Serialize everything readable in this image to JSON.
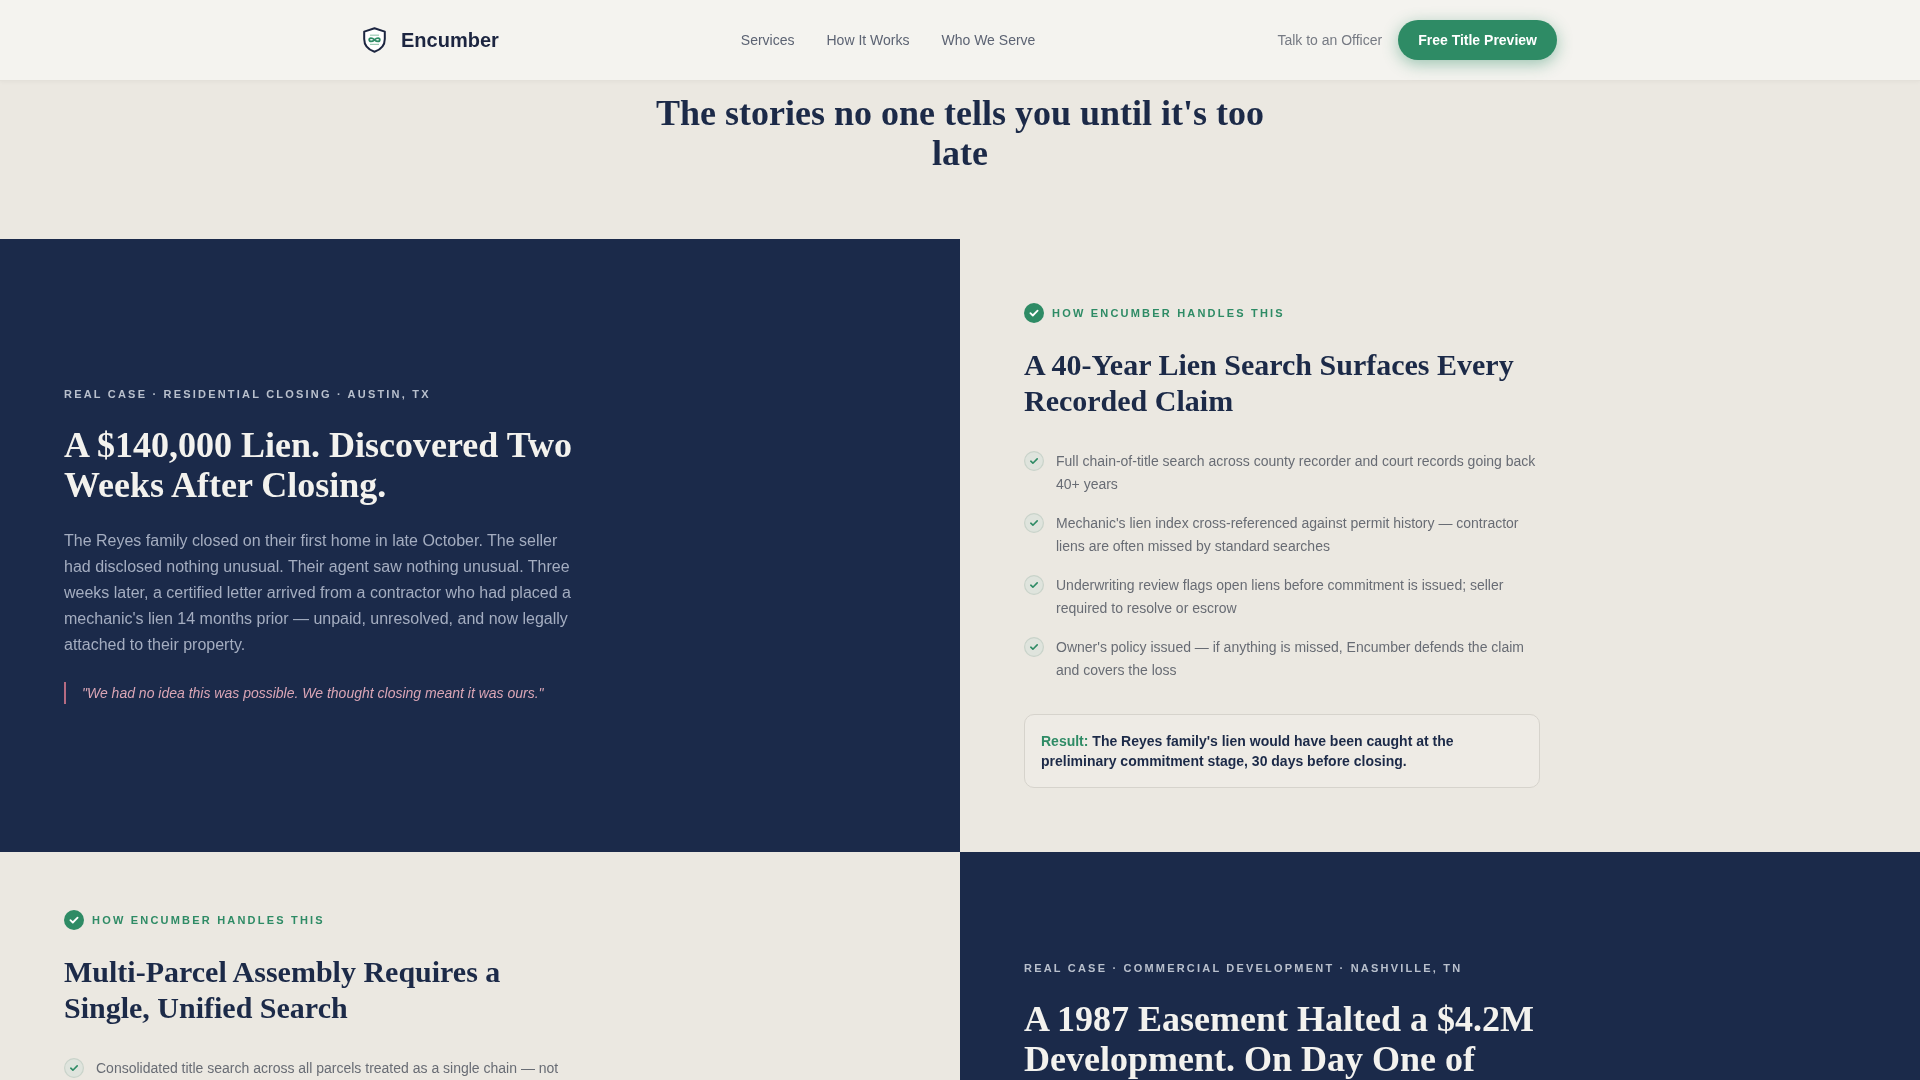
{
  "navbar": {
    "brand": "Encumber",
    "links": [
      "Services",
      "How It Works",
      "Who We Serve"
    ],
    "secondary_link": "Talk to an Officer",
    "cta_button": "Free Title Preview"
  },
  "intro": {
    "title": "The stories no one tells you until it's too late"
  },
  "case_rows": [
    {
      "panels": [
        {
          "kind": "story",
          "eyebrow": "REAL CASE · RESIDENTIAL CLOSING · AUSTIN, TX",
          "title": "A $140,000 Lien. Discovered Two Weeks After Closing.",
          "body": "The Reyes family closed on their first home in late October. The seller had disclosed nothing unusual. Their agent saw nothing unusual. Three weeks later, a certified letter arrived from a contractor who had placed a mechanic's lien 14 months prior — unpaid, unresolved, and now legally attached to their property.",
          "quote": "\"We had no idea this was possible. We thought closing meant it was ours.\""
        },
        {
          "kind": "solution",
          "eyebrow": "HOW ENCUMBER HANDLES THIS",
          "title": "A 40-Year Lien Search Surfaces Every Recorded Claim",
          "points": [
            "Full chain-of-title search across county recorder and court records going back 40+ years",
            "Mechanic's lien index cross-referenced against permit history — contractor liens are often missed by standard searches",
            "Underwriting review flags open liens before commitment is issued; seller required to resolve or escrow",
            "Owner's policy issued — if anything is missed, Encumber defends the claim and covers the loss"
          ],
          "result": {
            "label": "Result:",
            "text": "The Reyes family's lien would have been caught at the preliminary commitment stage, 30 days before closing."
          }
        }
      ]
    },
    {
      "panels": [
        {
          "kind": "solution",
          "eyebrow": "HOW ENCUMBER HANDLES THIS",
          "title": "Multi-Parcel Assembly Requires a Single, Unified Search",
          "points": [
            "Consolidated title search across all parcels treated as a single chain — not"
          ]
        },
        {
          "kind": "story",
          "eyebrow": "REAL CASE · COMMERCIAL DEVELOPMENT · NASHVILLE, TN",
          "title": "A 1987 Easement Halted a $4.2M Development. On Day One of"
        }
      ]
    }
  ]
}
